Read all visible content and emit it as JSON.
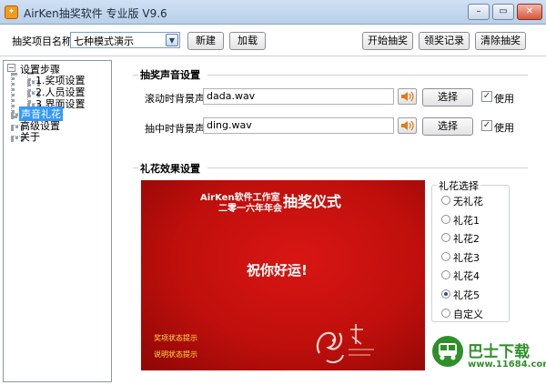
{
  "window": {
    "title": "AirKen抽奖软件 专业版 V9.6",
    "app_icon": "gift-icon",
    "controls": {
      "minimize": "–",
      "restore": "▭",
      "close": "✕"
    }
  },
  "toolbar": {
    "project_label": "抽奖项目名称",
    "project_value": "七种模式演示",
    "new_label": "新建",
    "load_label": "加载",
    "start_label": "开始抽奖",
    "records_label": "领奖记录",
    "clear_label": "清除抽奖"
  },
  "tree": {
    "root": "设置步骤",
    "children": [
      "1.奖项设置",
      "2.人员设置",
      "3.界面设置"
    ],
    "items": [
      "声音礼花",
      "高级设置",
      "关于"
    ],
    "selected": "声音礼花"
  },
  "sound": {
    "section_title": "抽奖声音设置",
    "rows": [
      {
        "label": "滚动时背景声:",
        "value": "dada.wav",
        "choose": "选择",
        "use": "使用",
        "checked": true
      },
      {
        "label": "抽中时背景声:",
        "value": "ding.wav",
        "choose": "选择",
        "use": "使用",
        "checked": true
      }
    ]
  },
  "fireworks": {
    "section_title": "礼花效果设置",
    "preview": {
      "company": "AirKen软件工作室",
      "subtitle": "二零一六年年会",
      "ceremony": "抽奖仪式",
      "wish": "祝你好运!",
      "footer": [
        "奖项状态提示",
        "说明状态提示"
      ]
    },
    "group_title": "礼花选择",
    "options": [
      "无礼花",
      "礼花1",
      "礼花2",
      "礼花3",
      "礼花4",
      "礼花5",
      "自定义"
    ],
    "selected": "礼花5"
  },
  "watermark": {
    "name": "巴士下载",
    "url": "www.11684.com"
  },
  "colors": {
    "accent": "#3399ff",
    "preview_red": "#d81613",
    "watermark_green": "#2f8f2a"
  }
}
